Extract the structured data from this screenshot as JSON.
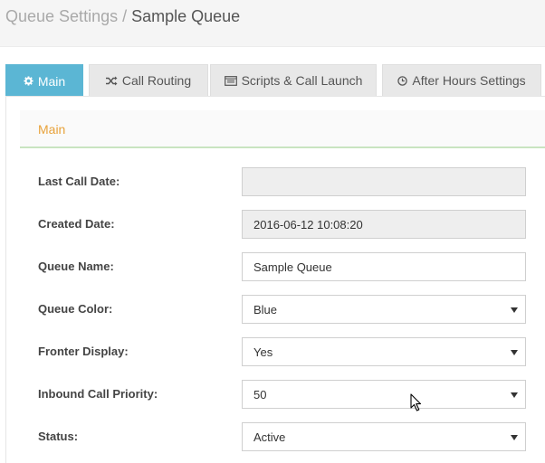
{
  "header": {
    "breadcrumb_parent": "Queue Settings",
    "breadcrumb_separator": " / ",
    "breadcrumb_current": "Sample Queue"
  },
  "tabs": [
    {
      "label": "Main",
      "icon": "gear-icon",
      "active": true
    },
    {
      "label": "Call Routing",
      "icon": "shuffle-icon",
      "active": false
    },
    {
      "label": "Scripts & Call Launch",
      "icon": "terminal-icon",
      "active": false
    },
    {
      "label": "After Hours Settings",
      "icon": "clock-icon",
      "active": false
    }
  ],
  "panel": {
    "title": "Main"
  },
  "form": {
    "last_call_date": {
      "label": "Last Call Date:",
      "value": ""
    },
    "created_date": {
      "label": "Created Date:",
      "value": "2016-06-12 10:08:20"
    },
    "queue_name": {
      "label": "Queue Name:",
      "value": "Sample Queue"
    },
    "queue_color": {
      "label": "Queue Color:",
      "value": "Blue"
    },
    "fronter_display": {
      "label": "Fronter Display:",
      "value": "Yes"
    },
    "inbound_call_priority": {
      "label": "Inbound Call Priority:",
      "value": "50"
    },
    "status": {
      "label": "Status:",
      "value": "Active"
    }
  },
  "colors": {
    "active_tab": "#5bb6d4",
    "panel_title": "#e8a23a",
    "panel_underline": "#c8e4c0"
  }
}
